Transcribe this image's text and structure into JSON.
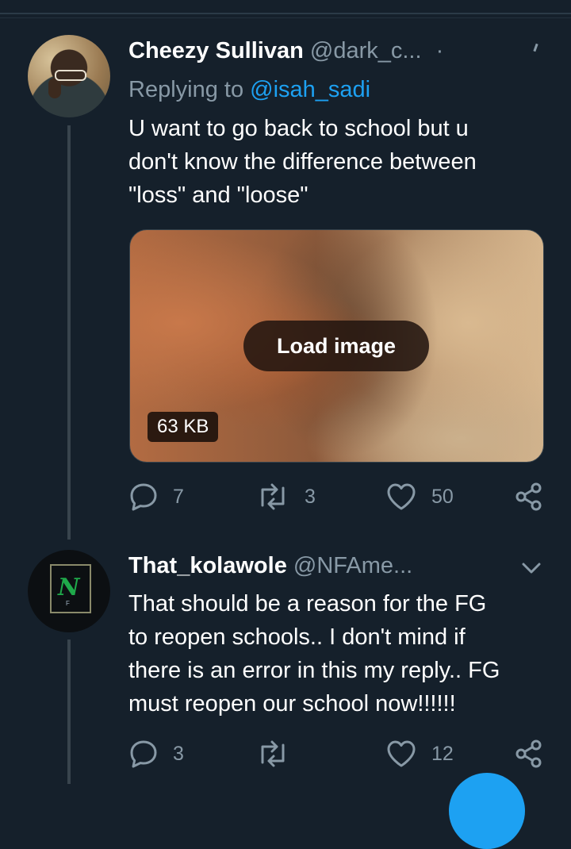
{
  "tweets": [
    {
      "name": "Cheezy Sullivan",
      "handle": "@dark_c...",
      "separator": "·",
      "replying_to_label": "Replying to",
      "replying_to_handle": "@isah_sadi",
      "text_lines": [
        "U want to go back to school but u",
        "don't know the difference between",
        "\"loss\" and \"loose\""
      ],
      "media": {
        "load_label": "Load image",
        "size_label": "63 KB"
      },
      "actions": {
        "replies": "7",
        "retweets": "3",
        "likes": "50"
      }
    },
    {
      "name": "That_kolawole",
      "handle": "@NFAme...",
      "text_lines": [
        "That should be a reason for the FG",
        "to reopen schools.. I don't mind if",
        "there is an error in this my reply..  FG",
        "must reopen our school now!!!!!!"
      ],
      "actions": {
        "replies": "3",
        "retweets": "",
        "likes": "12"
      }
    }
  ],
  "colors": {
    "background": "#15202b",
    "text": "#ffffff",
    "secondary": "#8899a6",
    "accent": "#1da1f2",
    "thread_line": "#38444d"
  },
  "icons": [
    "reply-icon",
    "retweet-icon",
    "like-icon",
    "share-icon",
    "chevron-down-icon"
  ]
}
